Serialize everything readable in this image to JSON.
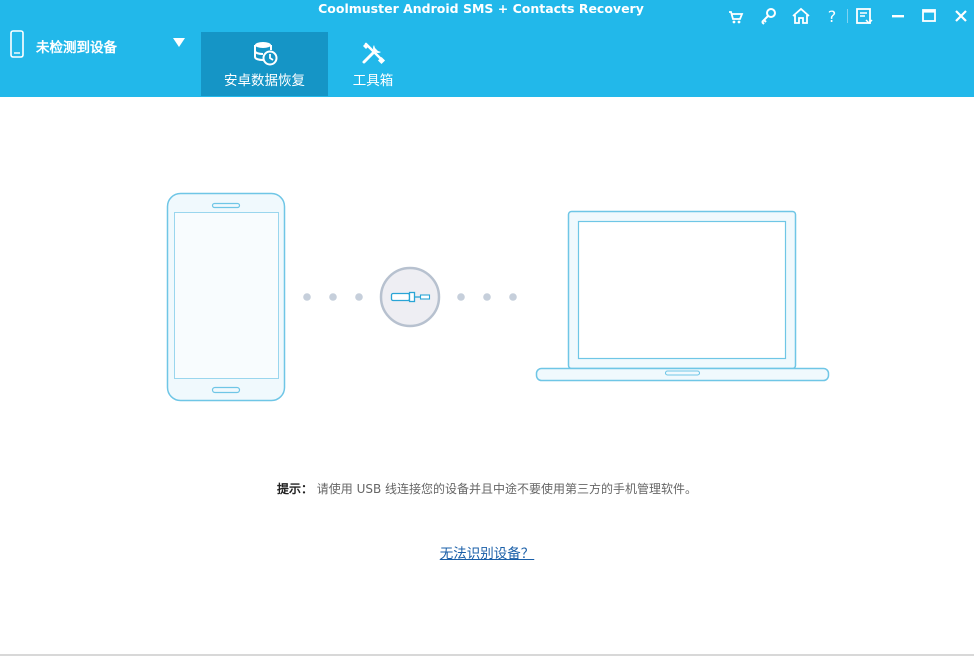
{
  "window": {
    "title": "Coolmuster Android SMS + Contacts Recovery",
    "controls": [
      "cart-icon",
      "key-icon",
      "home-icon",
      "help-icon",
      "feedback-icon",
      "minimize-icon",
      "maximize-icon",
      "close-icon"
    ]
  },
  "device": {
    "status": "未检测到设备",
    "icon": "phone-icon"
  },
  "tabs": [
    {
      "label": "安卓数据恢复",
      "icon": "database-recovery-icon",
      "active": true
    },
    {
      "label": "工具箱",
      "icon": "tools-icon",
      "active": false
    }
  ],
  "main": {
    "hint_label": "提示：",
    "hint_text": "请使用 USB 线连接您的设备并且中途不要使用第三方的手机管理软件。",
    "help_link": "无法识别设备？"
  },
  "colors": {
    "header": "#22b8ea",
    "active_tab": "#1595c6",
    "illustration_stroke": "#6fc6e6",
    "illustration_fill": "#f0f9fd",
    "link": "#1a5fa8"
  }
}
